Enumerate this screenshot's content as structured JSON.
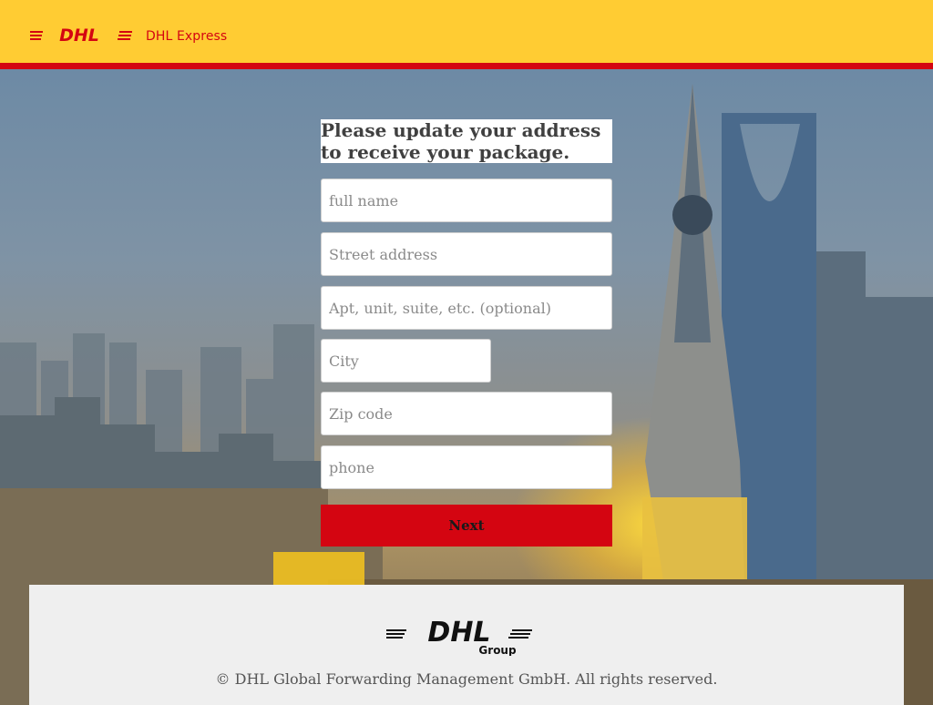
{
  "header": {
    "logo_text": "DHL",
    "brand_suffix": "DHL Express",
    "colors": {
      "yellow": "#ffcc33",
      "red": "#d40511"
    }
  },
  "form": {
    "title": "Please update your address to receive your package.",
    "fields": {
      "full_name": {
        "placeholder": "full name",
        "value": ""
      },
      "street": {
        "placeholder": "Street address",
        "value": ""
      },
      "apt": {
        "placeholder": "Apt, unit, suite, etc. (optional)",
        "value": ""
      },
      "city": {
        "placeholder": "City",
        "value": ""
      },
      "zip": {
        "placeholder": "Zip code",
        "value": ""
      },
      "phone": {
        "placeholder": "phone",
        "value": ""
      }
    },
    "submit_label": "Next"
  },
  "footer": {
    "logo_text": "DHL",
    "logo_subtitle": "Group",
    "copyright": "© DHL Global Forwarding Management GmbH. All rights reserved."
  }
}
